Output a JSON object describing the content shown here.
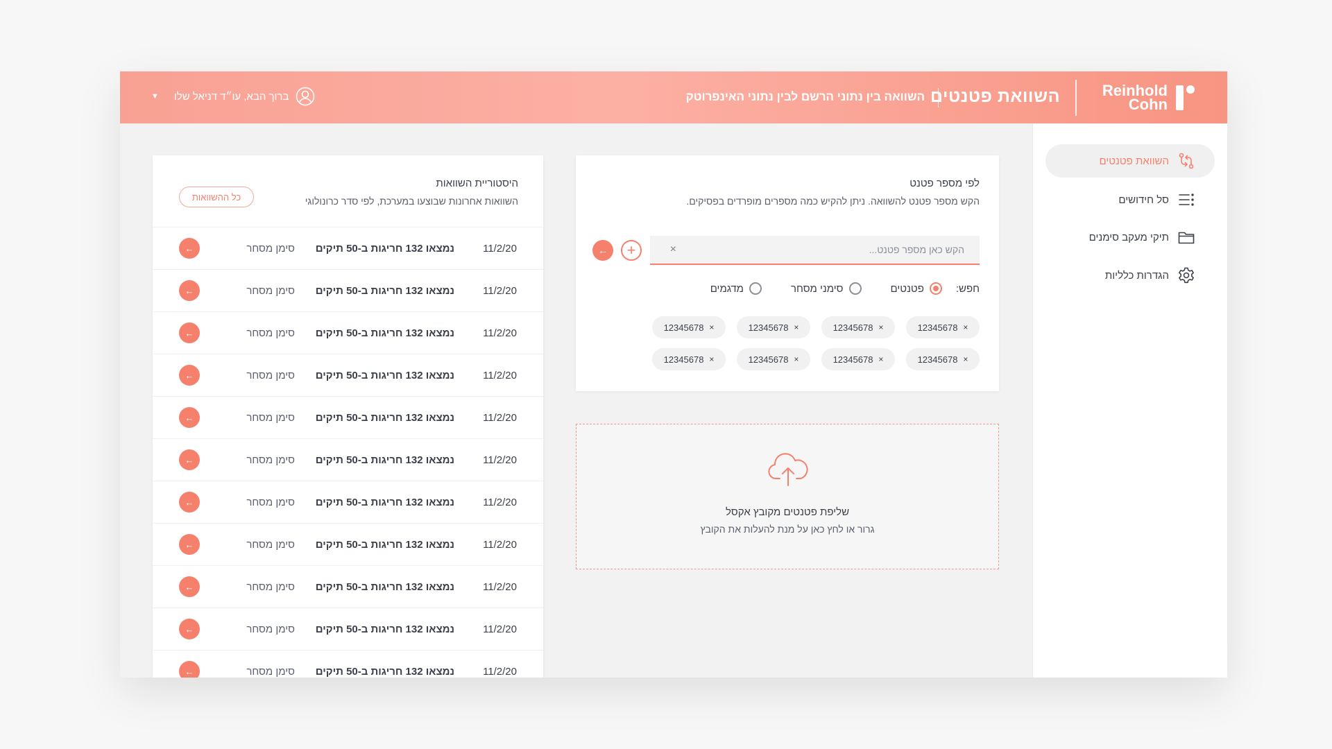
{
  "header": {
    "logo_text": "Reinhold Cohn",
    "title": "השוואת פטנטים",
    "subtitle": "השוואה בין נתוני הרשם לבין נתוני האינפרוטק",
    "user_greeting": "ברוך הבא, עו״ד דניאל שלו",
    "user_icon": "user-circle-icon",
    "caret_icon": "caret-down-icon"
  },
  "sidebar": {
    "items": [
      {
        "label": "השוואת פטנטים",
        "icon": "compare-arrows-icon",
        "active": true
      },
      {
        "label": "סל חידושים",
        "icon": "list-icon",
        "active": false
      },
      {
        "label": "תיקי מעקב סימנים",
        "icon": "folder-icon",
        "active": false
      },
      {
        "label": "הגדרות כלליות",
        "icon": "gear-icon",
        "active": false
      }
    ]
  },
  "search": {
    "title": "לפי מספר פטנט",
    "description": "הקש מספר פטנט להשוואה. ניתן להקיש כמה מספרים מופרדים בפסיקים.",
    "placeholder": "הקש כאן מספר פטנט...",
    "clear_icon": "×",
    "add_icon": "+",
    "go_icon": "←",
    "filter_label": "חפש:",
    "filters": [
      {
        "label": "פטנטים",
        "checked": true
      },
      {
        "label": "סימני מסחר",
        "checked": false
      },
      {
        "label": "מדגמים",
        "checked": false
      }
    ],
    "chips": [
      "12345678",
      "12345678",
      "12345678",
      "12345678",
      "12345678",
      "12345678",
      "12345678",
      "12345678"
    ],
    "chip_remove": "×"
  },
  "upload": {
    "icon": "cloud-upload-icon",
    "title": "שליפת פטנטים מקובץ אקסל",
    "description": "גרור או לחץ כאן על מנת להעלות את הקובץ"
  },
  "history": {
    "title": "היסטוריית השוואות",
    "description": "השוואות אחרונות שבוצעו במערכת, לפי סדר כרונולוגי",
    "all_button": "כל ההשוואות",
    "rows": [
      {
        "date": "11/2/20",
        "text": "נמצאו 132 חריגות ב-50 תיקים",
        "type": "סימן מסחר"
      },
      {
        "date": "11/2/20",
        "text": "נמצאו 132 חריגות ב-50 תיקים",
        "type": "סימן מסחר"
      },
      {
        "date": "11/2/20",
        "text": "נמצאו 132 חריגות ב-50 תיקים",
        "type": "סימן מסחר"
      },
      {
        "date": "11/2/20",
        "text": "נמצאו 132 חריגות ב-50 תיקים",
        "type": "סימן מסחר"
      },
      {
        "date": "11/2/20",
        "text": "נמצאו 132 חריגות ב-50 תיקים",
        "type": "סימן מסחר"
      },
      {
        "date": "11/2/20",
        "text": "נמצאו 132 חריגות ב-50 תיקים",
        "type": "סימן מסחר"
      },
      {
        "date": "11/2/20",
        "text": "נמצאו 132 חריגות ב-50 תיקים",
        "type": "סימן מסחר"
      },
      {
        "date": "11/2/20",
        "text": "נמצאו 132 חריגות ב-50 תיקים",
        "type": "סימן מסחר"
      },
      {
        "date": "11/2/20",
        "text": "נמצאו 132 חריגות ב-50 תיקים",
        "type": "סימן מסחר"
      },
      {
        "date": "11/2/20",
        "text": "נמצאו 132 חריגות ב-50 תיקים",
        "type": "סימן מסחר"
      },
      {
        "date": "11/2/20",
        "text": "נמצאו 132 חריגות ב-50 תיקים",
        "type": "סימן מסחר"
      }
    ],
    "row_arrow": "←"
  },
  "colors": {
    "accent": "#f5806c",
    "header_gradient_start": "#f8a193",
    "header_gradient_end": "#f89482"
  }
}
